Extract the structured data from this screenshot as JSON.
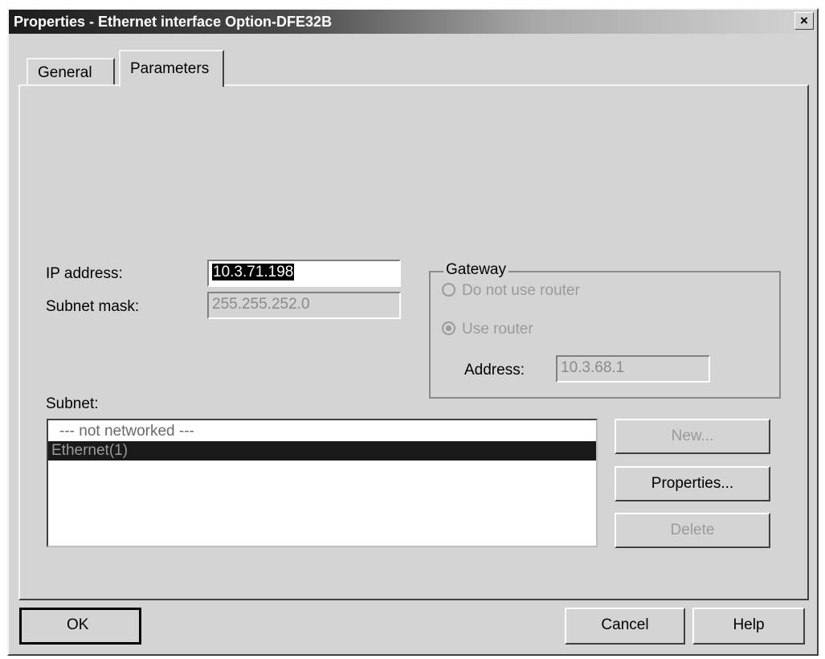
{
  "window": {
    "title": "Properties - Ethernet interface  Option-DFE32B",
    "close_glyph": "×"
  },
  "tabs": [
    {
      "label": "General",
      "active": false
    },
    {
      "label": "Parameters",
      "active": true
    }
  ],
  "ip": {
    "label": "IP address:",
    "value": "10.3.71.198"
  },
  "subnet_mask": {
    "label": "Subnet mask:",
    "value": "255.255.252.0"
  },
  "gateway": {
    "title": "Gateway",
    "option_no_router": "Do not use router",
    "option_use_router": "Use router",
    "selected": "use_router",
    "address_label": "Address:",
    "address_value": "10.3.68.1"
  },
  "subnet": {
    "label": "Subnet:",
    "items": [
      {
        "label": "--- not networked ---",
        "selected": false
      },
      {
        "label": "Ethernet(1)",
        "selected": true
      }
    ]
  },
  "side_buttons": {
    "new": "New...",
    "properties": "Properties...",
    "delete": "Delete"
  },
  "footer": {
    "ok": "OK",
    "cancel": "Cancel",
    "help": "Help"
  }
}
